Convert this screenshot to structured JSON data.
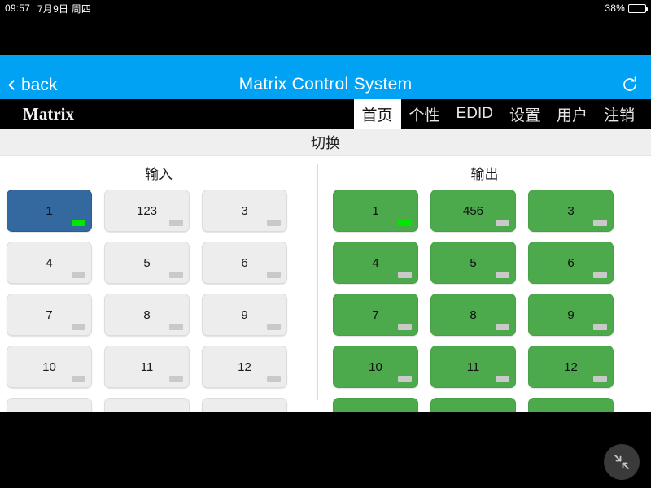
{
  "status_bar": {
    "time": "09:57",
    "date": "7月9日 周四",
    "battery_percent": "38%",
    "battery_level": 38
  },
  "title_bar": {
    "back_label": "back",
    "title": "Matrix Control System",
    "refresh_icon": "refresh-icon",
    "background_color": "#01A2F3"
  },
  "nav_bar": {
    "brand": "Matrix",
    "items": [
      {
        "label": "首页",
        "active": true
      },
      {
        "label": "个性",
        "active": false
      },
      {
        "label": "EDID",
        "active": false
      },
      {
        "label": "设置",
        "active": false
      },
      {
        "label": "用户",
        "active": false
      },
      {
        "label": "注销",
        "active": false
      }
    ]
  },
  "main": {
    "section_title": "切换",
    "input": {
      "header": "输入",
      "buttons": [
        {
          "label": "1",
          "selected": true,
          "indicator": "on"
        },
        {
          "label": "123",
          "selected": false,
          "indicator": "off"
        },
        {
          "label": "3",
          "selected": false,
          "indicator": "off"
        },
        {
          "label": "4",
          "selected": false,
          "indicator": "off"
        },
        {
          "label": "5",
          "selected": false,
          "indicator": "off"
        },
        {
          "label": "6",
          "selected": false,
          "indicator": "off"
        },
        {
          "label": "7",
          "selected": false,
          "indicator": "off"
        },
        {
          "label": "8",
          "selected": false,
          "indicator": "off"
        },
        {
          "label": "9",
          "selected": false,
          "indicator": "off"
        },
        {
          "label": "10",
          "selected": false,
          "indicator": "off"
        },
        {
          "label": "11",
          "selected": false,
          "indicator": "off"
        },
        {
          "label": "12",
          "selected": false,
          "indicator": "off"
        },
        {
          "label": "",
          "selected": false,
          "indicator": "off"
        },
        {
          "label": "",
          "selected": false,
          "indicator": "off"
        },
        {
          "label": "",
          "selected": false,
          "indicator": "off"
        }
      ]
    },
    "output": {
      "header": "输出",
      "buttons": [
        {
          "label": "1",
          "indicator": "on"
        },
        {
          "label": "456",
          "indicator": "off"
        },
        {
          "label": "3",
          "indicator": "off"
        },
        {
          "label": "4",
          "indicator": "off"
        },
        {
          "label": "5",
          "indicator": "off"
        },
        {
          "label": "6",
          "indicator": "off"
        },
        {
          "label": "7",
          "indicator": "off"
        },
        {
          "label": "8",
          "indicator": "off"
        },
        {
          "label": "9",
          "indicator": "off"
        },
        {
          "label": "10",
          "indicator": "off"
        },
        {
          "label": "11",
          "indicator": "off"
        },
        {
          "label": "12",
          "indicator": "off"
        },
        {
          "label": "",
          "indicator": "off"
        },
        {
          "label": "",
          "indicator": "off"
        },
        {
          "label": "",
          "indicator": "off"
        }
      ]
    }
  },
  "floating_button": {
    "icon": "collapse-arrows-icon"
  },
  "colors": {
    "accent_blue": "#01A2F3",
    "selected_blue": "#33699F",
    "output_green": "#4CA94C",
    "indicator_on": "#00E800",
    "indicator_off": "#C9C9C9"
  }
}
